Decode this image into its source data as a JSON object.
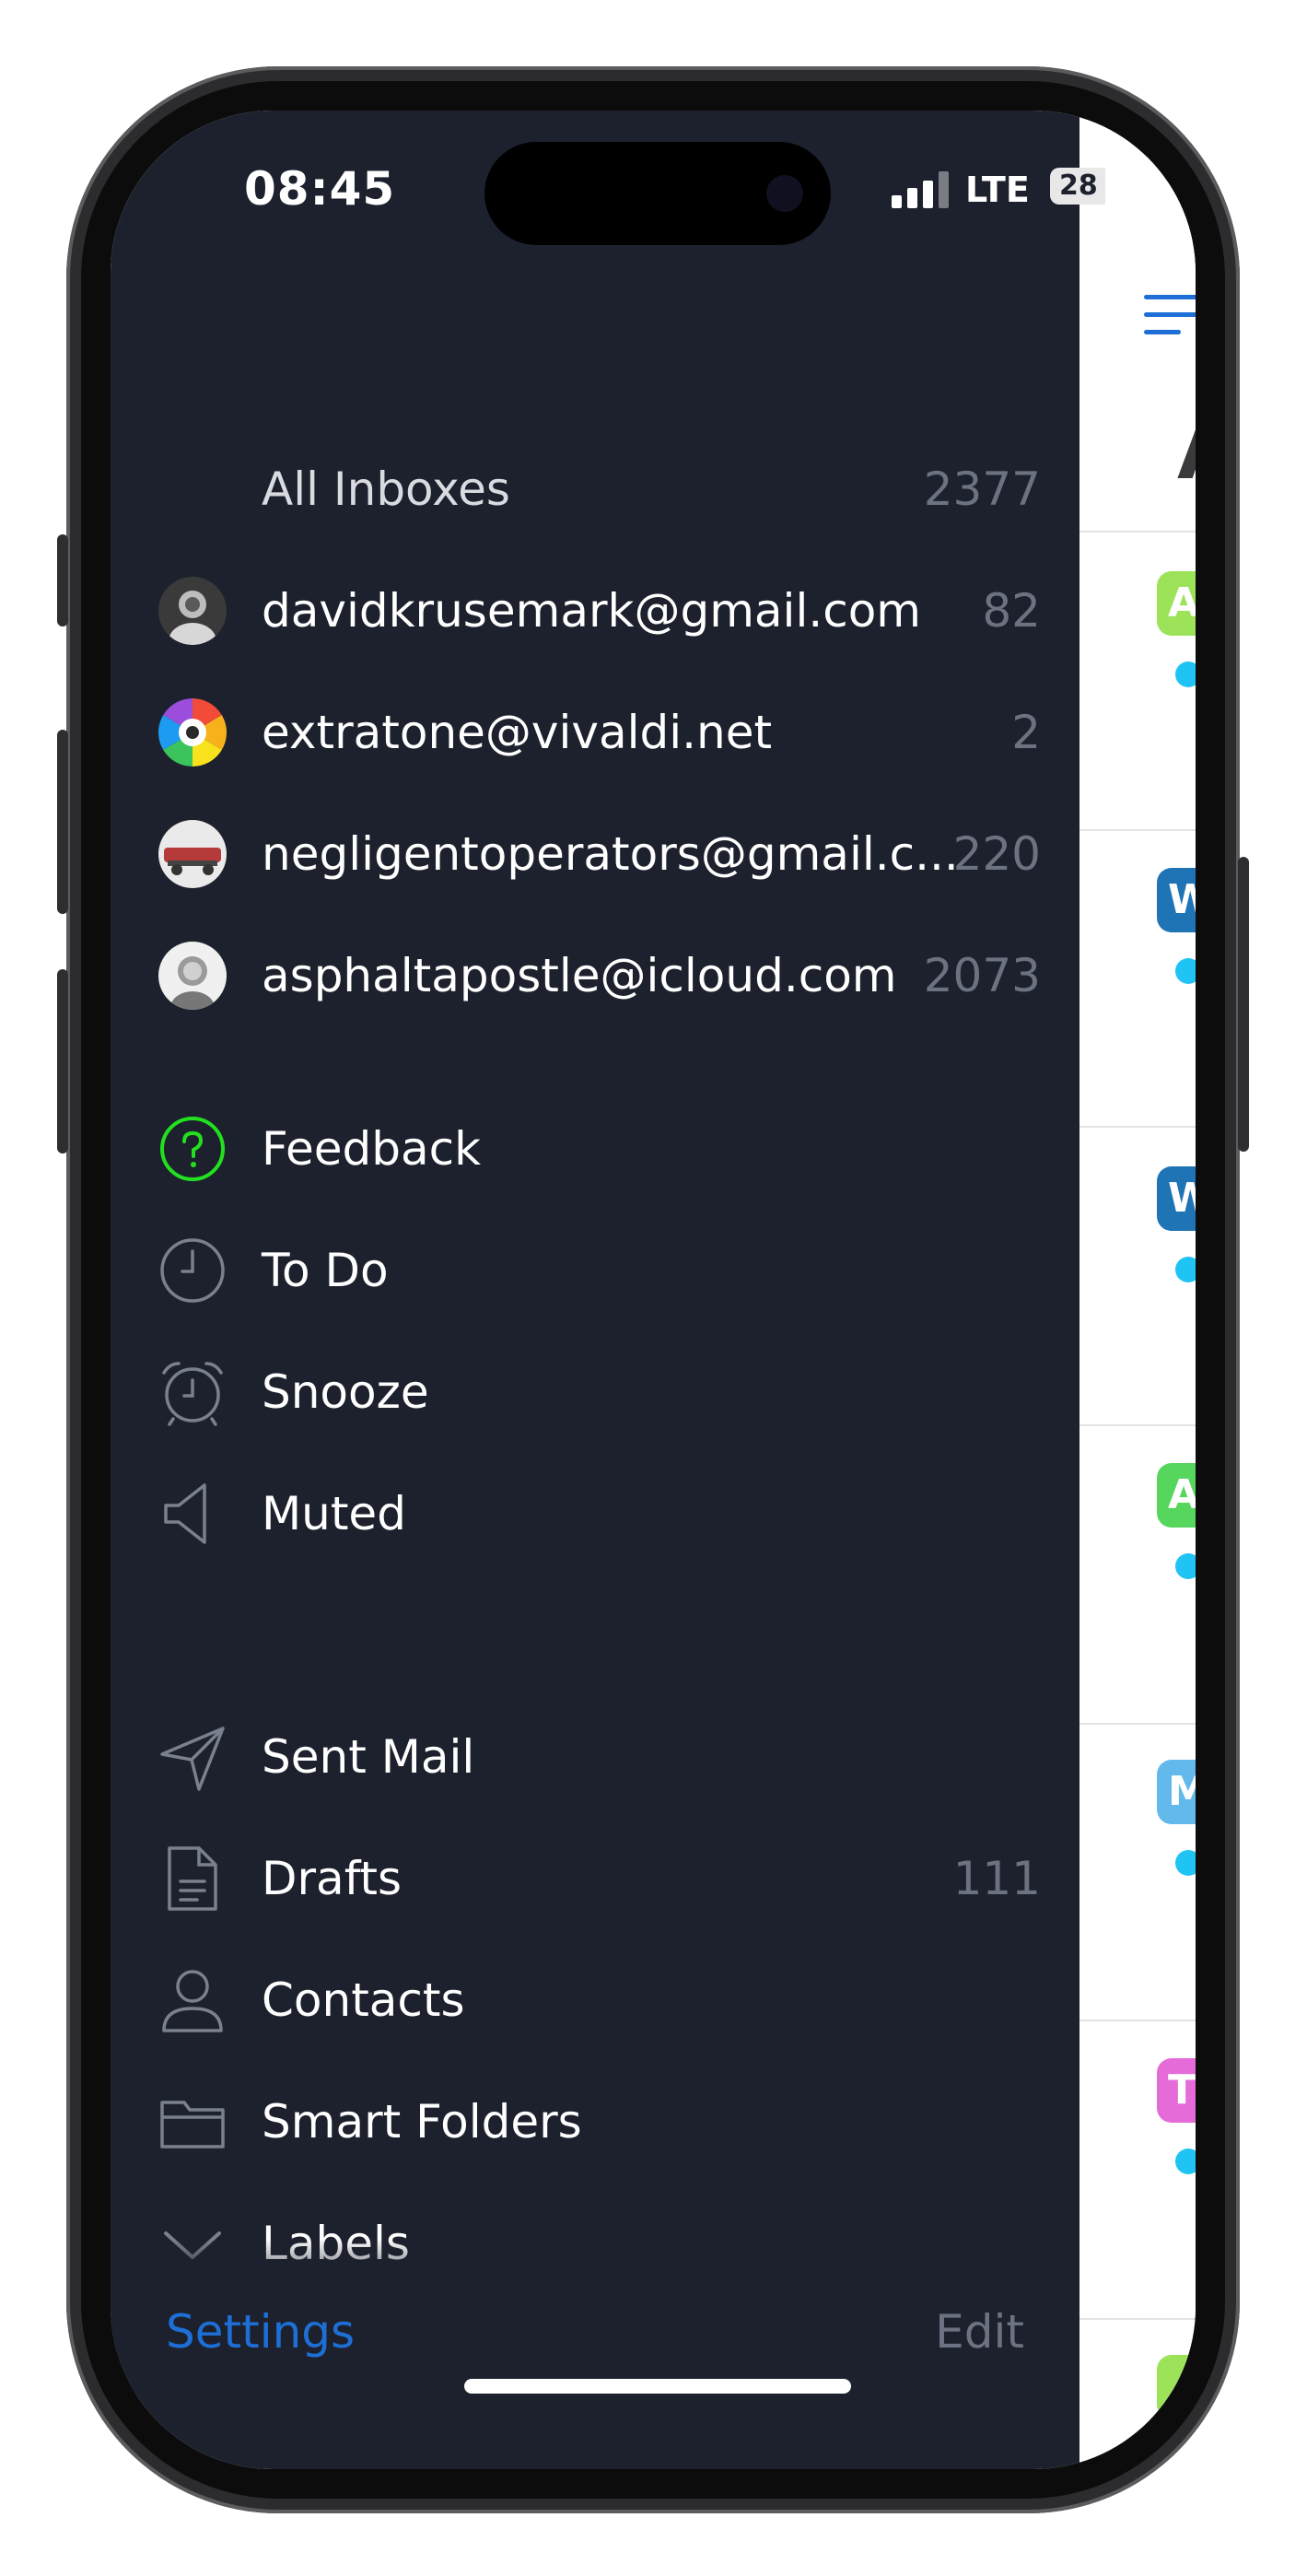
{
  "status_bar": {
    "time": "08:45",
    "network": "LTE",
    "battery": "28"
  },
  "accounts": [
    {
      "label": "All Inboxes",
      "count": "2377"
    },
    {
      "label": "davidkrusemark@gmail.com",
      "count": "82"
    },
    {
      "label": "extratone@vivaldi.net",
      "count": "2"
    },
    {
      "label": "negligentoperators@gmail.c...",
      "count": "220"
    },
    {
      "label": "asphaltapostle@icloud.com",
      "count": "2073"
    }
  ],
  "smart_items": [
    {
      "label": "Feedback",
      "icon": "question-circle-icon"
    },
    {
      "label": "To Do",
      "icon": "clock-icon"
    },
    {
      "label": "Snooze",
      "icon": "alarm-clock-icon"
    },
    {
      "label": "Muted",
      "icon": "speaker-muted-icon"
    }
  ],
  "folders": [
    {
      "label": "Sent Mail",
      "count": "",
      "icon": "paper-plane-icon"
    },
    {
      "label": "Drafts",
      "count": "111",
      "icon": "document-icon"
    },
    {
      "label": "Contacts",
      "count": "",
      "icon": "person-icon"
    },
    {
      "label": "Smart Folders",
      "count": "",
      "icon": "folder-icon"
    },
    {
      "label": "Labels",
      "count": "",
      "icon": "chevron-down-icon"
    }
  ],
  "bottom": {
    "settings_label": "Settings",
    "edit_label": "Edit"
  },
  "right_pane": {
    "title_letter": "A",
    "badges": [
      {
        "letter": "A",
        "color": "#9ce35a"
      },
      {
        "letter": "W",
        "color": "#1e74b5"
      },
      {
        "letter": "W",
        "color": "#1e74b5"
      },
      {
        "letter": "A",
        "color": "#57d65d"
      },
      {
        "letter": "M",
        "color": "#64b9ec"
      },
      {
        "letter": "T",
        "color": "#e56bd8"
      },
      {
        "letter": "",
        "color": "#9ce35a"
      }
    ]
  },
  "colors": {
    "sidebar_bg": "#1d212d",
    "accent": "#1d6fd6",
    "feedback_green": "#22e01f",
    "unread_dot": "#20c4f4"
  }
}
